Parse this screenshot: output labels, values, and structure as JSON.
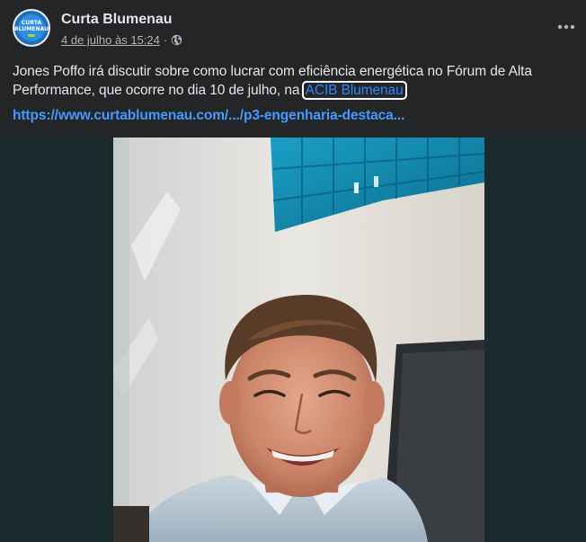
{
  "post": {
    "page_name": "Curta Blumenau",
    "date": "4 de julho às 15:24",
    "separator": "·",
    "privacy_icon": "globe-icon",
    "more_icon": "more-horizontal-icon",
    "avatar": {
      "line1": "CURTA",
      "line2": "BLUMENAU"
    },
    "text_before": "Jones Poffo irá discutir sobre como lucrar com eficiência energética no Fórum de Alta Performance, que ocorre no dia 10 de julho, na",
    "mention": "ACIB Blumenau",
    "link": "https://www.curtablumenau.com/.../p3-engenharia-destaca..."
  },
  "colors": {
    "background": "#242526",
    "text": "#e4e6eb",
    "secondary_text": "#b0b3b8",
    "link": "#4599ff",
    "mention": "#2d88ff"
  }
}
